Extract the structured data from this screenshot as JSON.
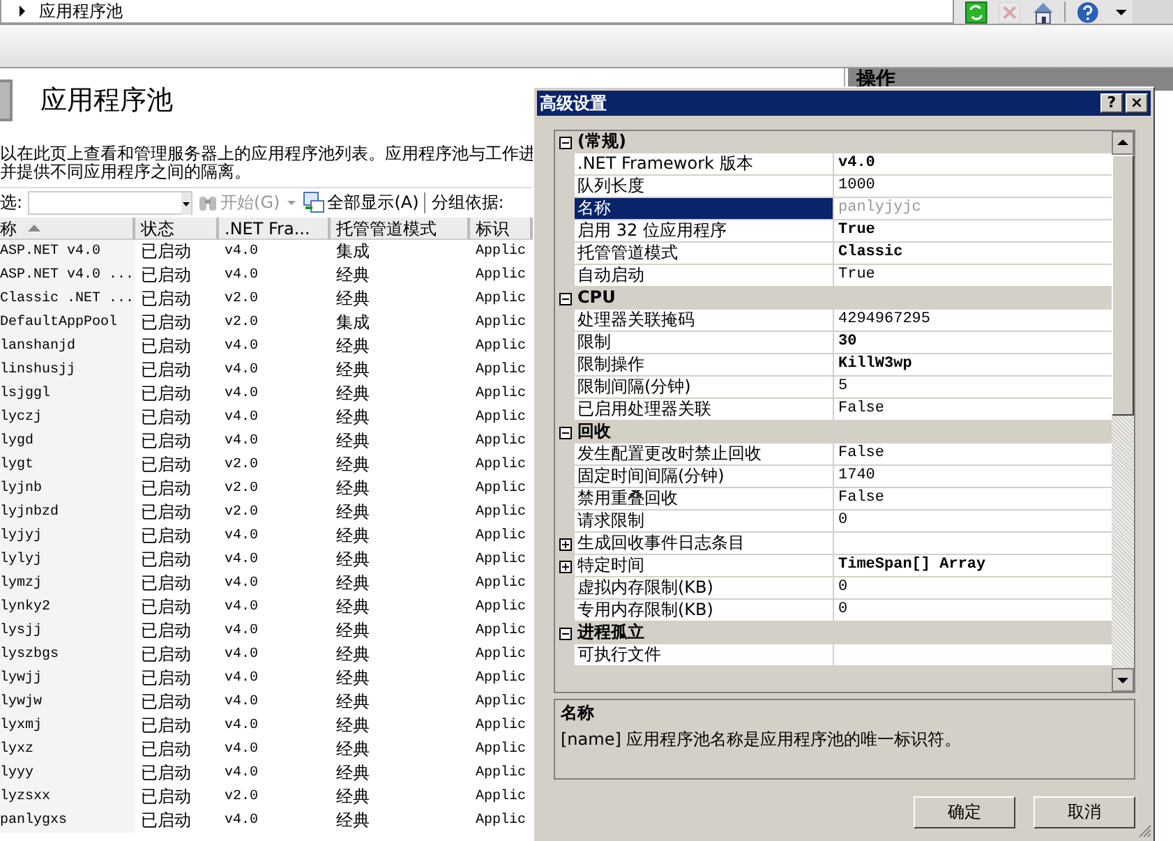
{
  "address_bar": {
    "path": "应用程序池"
  },
  "toolbar": [
    {
      "kind": "refresh",
      "disabled": false
    },
    {
      "kind": "stop",
      "disabled": true
    },
    {
      "kind": "home",
      "disabled": false
    },
    {
      "kind": "help",
      "disabled": false
    },
    {
      "kind": "more",
      "disabled": false
    }
  ],
  "page": {
    "title": "应用程序池",
    "description": [
      "以在此页上查看和管理服务器上的应用程序池列表。应用程序池与工作进",
      "并提供不同应用程序之间的隔离。"
    ]
  },
  "filter_bar": {
    "label": "选:",
    "start": "开始(G)",
    "start_disabled": true,
    "show_all": "全部显示(A)",
    "group_by": "分组依据:"
  },
  "actions_pane": {
    "title": "操作"
  },
  "table": {
    "columns": [
      {
        "label": "称",
        "sorted": true
      },
      {
        "label": "状态",
        "sorted": false
      },
      {
        "label": ".NET Fra...",
        "sorted": false
      },
      {
        "label": "托管管道模式",
        "sorted": false
      },
      {
        "label": "标识",
        "sorted": false
      }
    ],
    "rows": [
      [
        "ASP.NET v4.0",
        "已启动",
        "v4.0",
        "集成",
        "Applic"
      ],
      [
        "ASP.NET v4.0 ...",
        "已启动",
        "v4.0",
        "经典",
        "Applic"
      ],
      [
        "Classic .NET ...",
        "已启动",
        "v2.0",
        "经典",
        "Applic"
      ],
      [
        "DefaultAppPool",
        "已启动",
        "v2.0",
        "集成",
        "Applic"
      ],
      [
        "lanshanjd",
        "已启动",
        "v4.0",
        "经典",
        "Applic"
      ],
      [
        "linshusjj",
        "已启动",
        "v4.0",
        "经典",
        "Applic"
      ],
      [
        "lsjggl",
        "已启动",
        "v4.0",
        "经典",
        "Applic"
      ],
      [
        "lyczj",
        "已启动",
        "v4.0",
        "经典",
        "Applic"
      ],
      [
        "lygd",
        "已启动",
        "v4.0",
        "经典",
        "Applic"
      ],
      [
        "lygt",
        "已启动",
        "v2.0",
        "经典",
        "Applic"
      ],
      [
        "lyjnb",
        "已启动",
        "v2.0",
        "经典",
        "Applic"
      ],
      [
        "lyjnbzd",
        "已启动",
        "v2.0",
        "经典",
        "Applic"
      ],
      [
        "lyjyj",
        "已启动",
        "v4.0",
        "经典",
        "Applic"
      ],
      [
        "lylyj",
        "已启动",
        "v4.0",
        "经典",
        "Applic"
      ],
      [
        "lymzj",
        "已启动",
        "v4.0",
        "经典",
        "Applic"
      ],
      [
        "lynky2",
        "已启动",
        "v4.0",
        "经典",
        "Applic"
      ],
      [
        "lysjj",
        "已启动",
        "v4.0",
        "经典",
        "Applic"
      ],
      [
        "lyszbgs",
        "已启动",
        "v4.0",
        "经典",
        "Applic"
      ],
      [
        "lywjj",
        "已启动",
        "v4.0",
        "经典",
        "Applic"
      ],
      [
        "lywjw",
        "已启动",
        "v4.0",
        "经典",
        "Applic"
      ],
      [
        "lyxmj",
        "已启动",
        "v4.0",
        "经典",
        "Applic"
      ],
      [
        "lyxz",
        "已启动",
        "v4.0",
        "经典",
        "Applic"
      ],
      [
        "lyyy",
        "已启动",
        "v4.0",
        "经典",
        "Applic"
      ],
      [
        "lyzsxx",
        "已启动",
        "v2.0",
        "经典",
        "Applic"
      ],
      [
        "panlygxs",
        "已启动",
        "v4.0",
        "经典",
        "Applic"
      ]
    ]
  },
  "dialog": {
    "title": "高级设置",
    "help": "?",
    "close": "×",
    "sections": [
      {
        "title": "(常规)",
        "expanded": true,
        "properties": [
          {
            "name": ".NET Framework 版本",
            "value": "v4.0",
            "bold": true,
            "selected": false,
            "disabled": false
          },
          {
            "name": "队列长度",
            "value": "1000",
            "bold": false,
            "selected": false,
            "disabled": false
          },
          {
            "name": "名称",
            "value": "panlyjyjc",
            "bold": false,
            "selected": true,
            "disabled": true
          },
          {
            "name": "启用 32 位应用程序",
            "value": "True",
            "bold": true,
            "selected": false,
            "disabled": false
          },
          {
            "name": "托管管道模式",
            "value": "Classic",
            "bold": true,
            "selected": false,
            "disabled": false
          },
          {
            "name": "自动启动",
            "value": "True",
            "bold": false,
            "selected": false,
            "disabled": false
          }
        ]
      },
      {
        "title": "CPU",
        "expanded": true,
        "properties": [
          {
            "name": "处理器关联掩码",
            "value": "4294967295",
            "bold": false,
            "selected": false,
            "disabled": false
          },
          {
            "name": "限制",
            "value": "30",
            "bold": true,
            "selected": false,
            "disabled": false
          },
          {
            "name": "限制操作",
            "value": "KillW3wp",
            "bold": true,
            "selected": false,
            "disabled": false
          },
          {
            "name": "限制间隔(分钟)",
            "value": "5",
            "bold": false,
            "selected": false,
            "disabled": false
          },
          {
            "name": "已启用处理器关联",
            "value": "False",
            "bold": false,
            "selected": false,
            "disabled": false
          }
        ]
      },
      {
        "title": "回收",
        "expanded": true,
        "properties": [
          {
            "name": "发生配置更改时禁止回收",
            "value": "False",
            "bold": false,
            "selected": false,
            "disabled": false
          },
          {
            "name": "固定时间间隔(分钟)",
            "value": "1740",
            "bold": false,
            "selected": false,
            "disabled": false
          },
          {
            "name": "禁用重叠回收",
            "value": "False",
            "bold": false,
            "selected": false,
            "disabled": false
          },
          {
            "name": "请求限制",
            "value": "0",
            "bold": false,
            "selected": false,
            "disabled": false
          },
          {
            "name": "生成回收事件日志条目",
            "selected": false,
            "kind": "group",
            "expanded": false
          },
          {
            "name": "特定时间",
            "value": "TimeSpan[] Array",
            "bold": true,
            "selected": false,
            "disabled": false,
            "kind": "group",
            "expanded": false
          },
          {
            "name": "虚拟内存限制(KB)",
            "value": "0",
            "bold": false,
            "selected": false,
            "disabled": false
          },
          {
            "name": "专用内存限制(KB)",
            "value": "0",
            "bold": false,
            "selected": false,
            "disabled": false
          }
        ]
      },
      {
        "title": "进程孤立",
        "expanded": true,
        "properties": [
          {
            "name": "可执行文件",
            "selected": false
          }
        ]
      }
    ],
    "help_title": "名称",
    "help_text": "[name] 应用程序池名称是应用程序池的唯一标识符。",
    "buttons": [
      "确定",
      "取消"
    ]
  }
}
